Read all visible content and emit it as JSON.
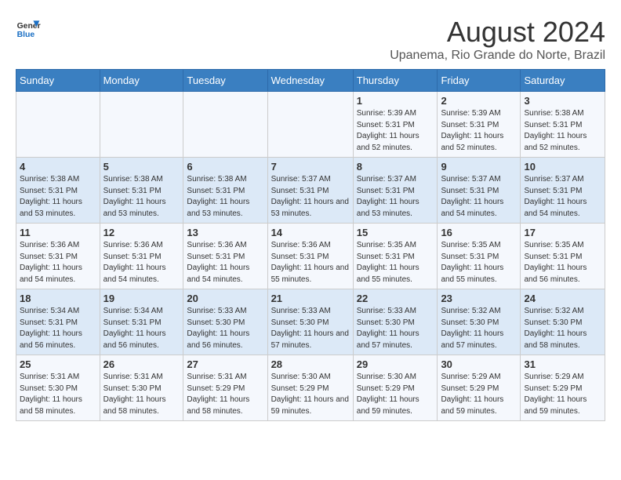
{
  "header": {
    "logo_line1": "General",
    "logo_line2": "Blue",
    "title": "August 2024",
    "subtitle": "Upanema, Rio Grande do Norte, Brazil"
  },
  "days_of_week": [
    "Sunday",
    "Monday",
    "Tuesday",
    "Wednesday",
    "Thursday",
    "Friday",
    "Saturday"
  ],
  "weeks": [
    [
      {
        "day": "",
        "info": ""
      },
      {
        "day": "",
        "info": ""
      },
      {
        "day": "",
        "info": ""
      },
      {
        "day": "",
        "info": ""
      },
      {
        "day": "1",
        "info": "Sunrise: 5:39 AM\nSunset: 5:31 PM\nDaylight: 11 hours and 52 minutes."
      },
      {
        "day": "2",
        "info": "Sunrise: 5:39 AM\nSunset: 5:31 PM\nDaylight: 11 hours and 52 minutes."
      },
      {
        "day": "3",
        "info": "Sunrise: 5:38 AM\nSunset: 5:31 PM\nDaylight: 11 hours and 52 minutes."
      }
    ],
    [
      {
        "day": "4",
        "info": "Sunrise: 5:38 AM\nSunset: 5:31 PM\nDaylight: 11 hours and 53 minutes."
      },
      {
        "day": "5",
        "info": "Sunrise: 5:38 AM\nSunset: 5:31 PM\nDaylight: 11 hours and 53 minutes."
      },
      {
        "day": "6",
        "info": "Sunrise: 5:38 AM\nSunset: 5:31 PM\nDaylight: 11 hours and 53 minutes."
      },
      {
        "day": "7",
        "info": "Sunrise: 5:37 AM\nSunset: 5:31 PM\nDaylight: 11 hours and 53 minutes."
      },
      {
        "day": "8",
        "info": "Sunrise: 5:37 AM\nSunset: 5:31 PM\nDaylight: 11 hours and 53 minutes."
      },
      {
        "day": "9",
        "info": "Sunrise: 5:37 AM\nSunset: 5:31 PM\nDaylight: 11 hours and 54 minutes."
      },
      {
        "day": "10",
        "info": "Sunrise: 5:37 AM\nSunset: 5:31 PM\nDaylight: 11 hours and 54 minutes."
      }
    ],
    [
      {
        "day": "11",
        "info": "Sunrise: 5:36 AM\nSunset: 5:31 PM\nDaylight: 11 hours and 54 minutes."
      },
      {
        "day": "12",
        "info": "Sunrise: 5:36 AM\nSunset: 5:31 PM\nDaylight: 11 hours and 54 minutes."
      },
      {
        "day": "13",
        "info": "Sunrise: 5:36 AM\nSunset: 5:31 PM\nDaylight: 11 hours and 54 minutes."
      },
      {
        "day": "14",
        "info": "Sunrise: 5:36 AM\nSunset: 5:31 PM\nDaylight: 11 hours and 55 minutes."
      },
      {
        "day": "15",
        "info": "Sunrise: 5:35 AM\nSunset: 5:31 PM\nDaylight: 11 hours and 55 minutes."
      },
      {
        "day": "16",
        "info": "Sunrise: 5:35 AM\nSunset: 5:31 PM\nDaylight: 11 hours and 55 minutes."
      },
      {
        "day": "17",
        "info": "Sunrise: 5:35 AM\nSunset: 5:31 PM\nDaylight: 11 hours and 56 minutes."
      }
    ],
    [
      {
        "day": "18",
        "info": "Sunrise: 5:34 AM\nSunset: 5:31 PM\nDaylight: 11 hours and 56 minutes."
      },
      {
        "day": "19",
        "info": "Sunrise: 5:34 AM\nSunset: 5:31 PM\nDaylight: 11 hours and 56 minutes."
      },
      {
        "day": "20",
        "info": "Sunrise: 5:33 AM\nSunset: 5:30 PM\nDaylight: 11 hours and 56 minutes."
      },
      {
        "day": "21",
        "info": "Sunrise: 5:33 AM\nSunset: 5:30 PM\nDaylight: 11 hours and 57 minutes."
      },
      {
        "day": "22",
        "info": "Sunrise: 5:33 AM\nSunset: 5:30 PM\nDaylight: 11 hours and 57 minutes."
      },
      {
        "day": "23",
        "info": "Sunrise: 5:32 AM\nSunset: 5:30 PM\nDaylight: 11 hours and 57 minutes."
      },
      {
        "day": "24",
        "info": "Sunrise: 5:32 AM\nSunset: 5:30 PM\nDaylight: 11 hours and 58 minutes."
      }
    ],
    [
      {
        "day": "25",
        "info": "Sunrise: 5:31 AM\nSunset: 5:30 PM\nDaylight: 11 hours and 58 minutes."
      },
      {
        "day": "26",
        "info": "Sunrise: 5:31 AM\nSunset: 5:30 PM\nDaylight: 11 hours and 58 minutes."
      },
      {
        "day": "27",
        "info": "Sunrise: 5:31 AM\nSunset: 5:29 PM\nDaylight: 11 hours and 58 minutes."
      },
      {
        "day": "28",
        "info": "Sunrise: 5:30 AM\nSunset: 5:29 PM\nDaylight: 11 hours and 59 minutes."
      },
      {
        "day": "29",
        "info": "Sunrise: 5:30 AM\nSunset: 5:29 PM\nDaylight: 11 hours and 59 minutes."
      },
      {
        "day": "30",
        "info": "Sunrise: 5:29 AM\nSunset: 5:29 PM\nDaylight: 11 hours and 59 minutes."
      },
      {
        "day": "31",
        "info": "Sunrise: 5:29 AM\nSunset: 5:29 PM\nDaylight: 11 hours and 59 minutes."
      }
    ]
  ]
}
